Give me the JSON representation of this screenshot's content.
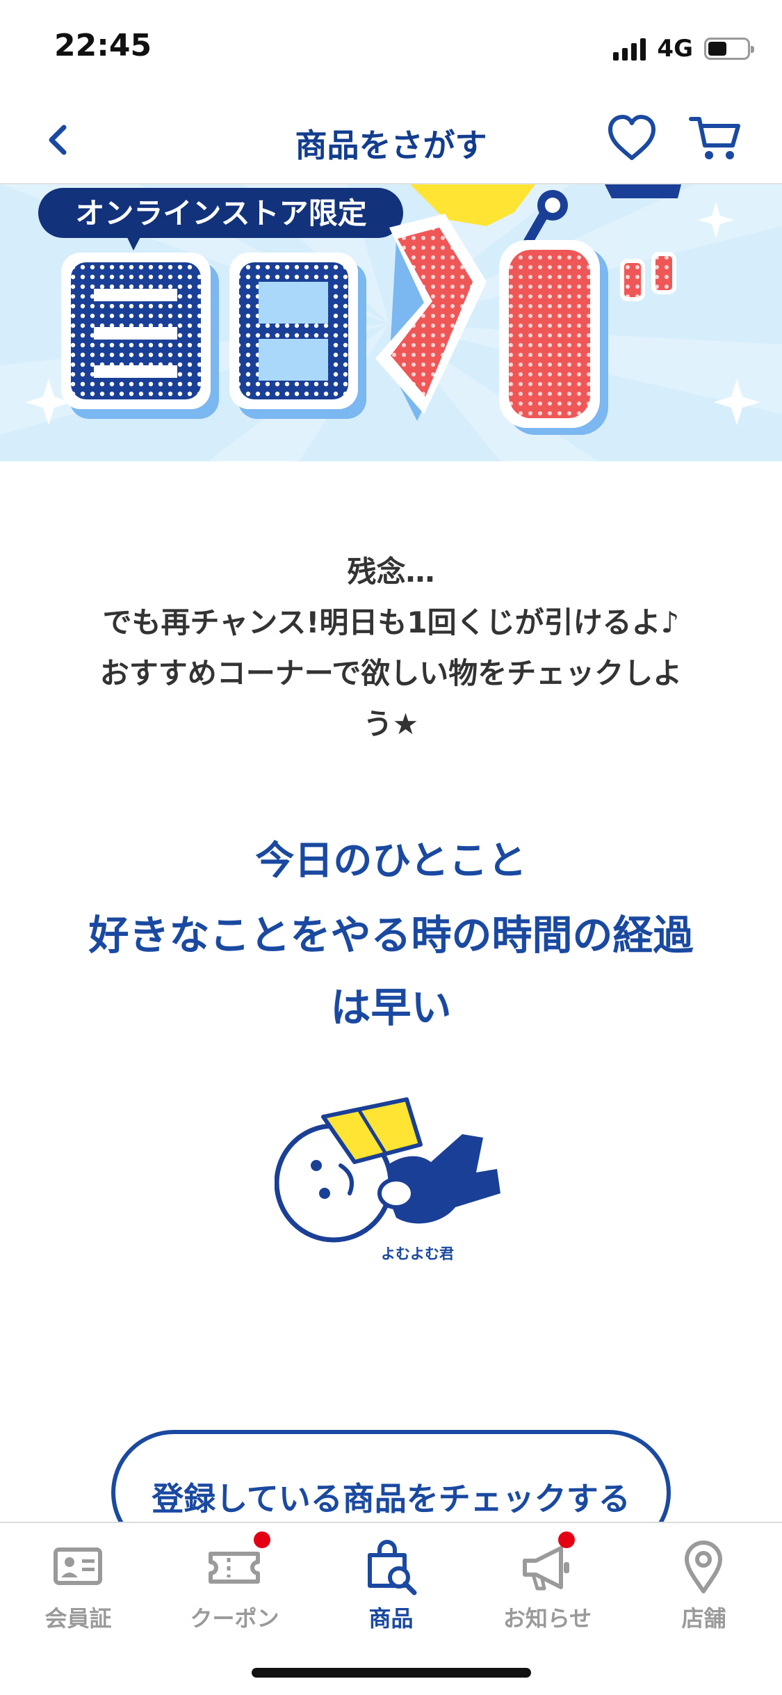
{
  "status": {
    "time": "22:45",
    "network": "4G",
    "battery_level": 0.44
  },
  "header": {
    "title": "商品をさがす"
  },
  "banner": {
    "tag": "オンラインストア限定",
    "title_chars": [
      "毎",
      "日",
      "く",
      "じ"
    ]
  },
  "message": {
    "lines": [
      "残念…",
      "でも再チャンス!明日も1回くじが引けるよ♪",
      "おすすめコーナーで欲しい物をチェックしよ",
      "う★"
    ]
  },
  "phrase": {
    "title": "今日のひとこと",
    "text_lines": [
      "好きなことをやる時の時間の経過",
      "は早い"
    ]
  },
  "character": {
    "name": "よむよむ君"
  },
  "check_button": {
    "label": "登録している商品をチェックする"
  },
  "tabs": [
    {
      "label": "会員証",
      "icon": "member-card-icon",
      "active": false,
      "badge": false
    },
    {
      "label": "クーポン",
      "icon": "coupon-icon",
      "active": false,
      "badge": true
    },
    {
      "label": "商品",
      "icon": "shopping-bag-search-icon",
      "active": true,
      "badge": false
    },
    {
      "label": "お知らせ",
      "icon": "megaphone-icon",
      "active": false,
      "badge": true
    },
    {
      "label": "店舗",
      "icon": "location-pin-icon",
      "active": false,
      "badge": false
    }
  ],
  "colors": {
    "brand": "#1a49a1",
    "title": "#123d8f",
    "badge": "#e40012",
    "banner_red": "#f05a5a",
    "banner_bg": "#d6eefb"
  }
}
